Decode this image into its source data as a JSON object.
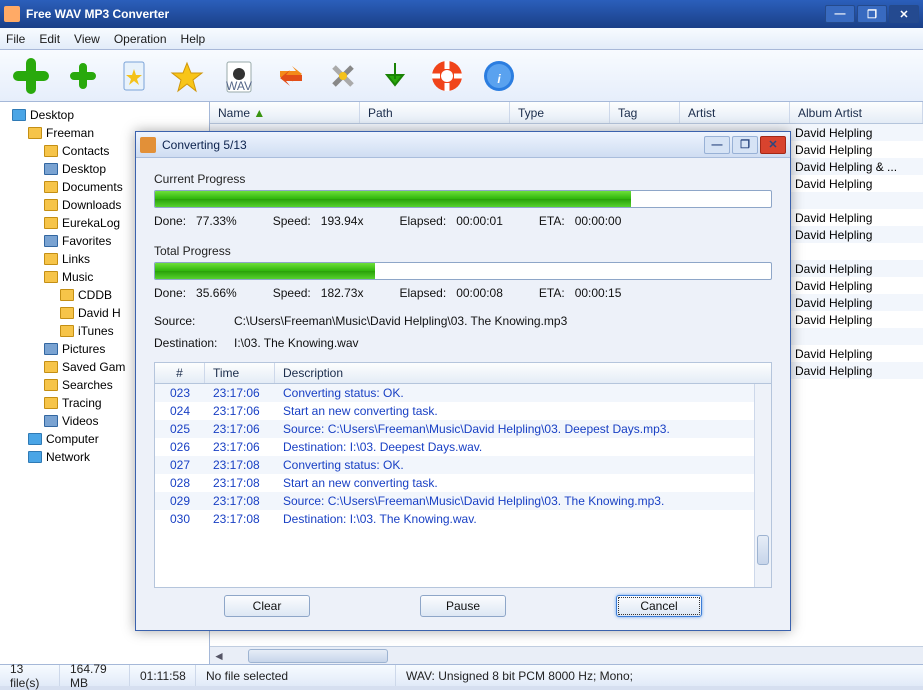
{
  "window": {
    "title": "Free WAV MP3 Converter"
  },
  "menu": [
    "File",
    "Edit",
    "View",
    "Operation",
    "Help"
  ],
  "toolbar_icons": [
    "add",
    "add-files",
    "favorites",
    "favorite-add",
    "output",
    "convert",
    "settings",
    "download",
    "help",
    "info"
  ],
  "tree": [
    {
      "ind": 0,
      "icon": "desk",
      "label": "Desktop"
    },
    {
      "ind": 1,
      "icon": "fld",
      "label": "Freeman"
    },
    {
      "ind": 2,
      "icon": "fld",
      "label": "Contacts"
    },
    {
      "ind": 2,
      "icon": "sp",
      "label": "Desktop"
    },
    {
      "ind": 2,
      "icon": "fld",
      "label": "Documents"
    },
    {
      "ind": 2,
      "icon": "fld",
      "label": "Downloads"
    },
    {
      "ind": 2,
      "icon": "fld",
      "label": "EurekaLog"
    },
    {
      "ind": 2,
      "icon": "sp",
      "label": "Favorites"
    },
    {
      "ind": 2,
      "icon": "fld",
      "label": "Links"
    },
    {
      "ind": 2,
      "icon": "fld",
      "label": "Music"
    },
    {
      "ind": 3,
      "icon": "fld",
      "label": "CDDB"
    },
    {
      "ind": 3,
      "icon": "fld",
      "label": "David H"
    },
    {
      "ind": 3,
      "icon": "fld",
      "label": "iTunes"
    },
    {
      "ind": 2,
      "icon": "sp",
      "label": "Pictures"
    },
    {
      "ind": 2,
      "icon": "fld",
      "label": "Saved Gam"
    },
    {
      "ind": 2,
      "icon": "fld",
      "label": "Searches"
    },
    {
      "ind": 2,
      "icon": "fld",
      "label": "Tracing"
    },
    {
      "ind": 2,
      "icon": "sp",
      "label": "Videos"
    },
    {
      "ind": 1,
      "icon": "net",
      "label": "Computer"
    },
    {
      "ind": 1,
      "icon": "net",
      "label": "Network"
    }
  ],
  "columns": {
    "name": "Name",
    "path": "Path",
    "type": "Type",
    "tag": "Tag",
    "artist": "Artist",
    "albumartist": "Album Artist"
  },
  "artist_rows": [
    "David Helpling",
    "David Helpling",
    "David Helpling & ...",
    "David Helpling",
    "",
    "David Helpling",
    "David Helpling",
    "",
    "David Helpling",
    "David Helpling",
    "David Helpling",
    "David Helpling",
    "",
    "David Helpling",
    "David Helpling"
  ],
  "status": {
    "files": "13 file(s)",
    "size": "164.79 MB",
    "dur": "01:11:58",
    "sel": "No file selected",
    "fmt": "WAV:   Unsigned 8 bit PCM  8000 Hz;  Mono;"
  },
  "dialog": {
    "title": "Converting 5/13",
    "current": {
      "label": "Current Progress",
      "donelab": "Done:",
      "done": "77.33%",
      "pct": 77.33,
      "speedlab": "Speed:",
      "speed": "193.94x",
      "elapsedlab": "Elapsed:",
      "elapsed": "00:00:01",
      "etalab": "ETA:",
      "eta": "00:00:00"
    },
    "total": {
      "label": "Total Progress",
      "donelab": "Done:",
      "done": "35.66%",
      "pct": 35.66,
      "speedlab": "Speed:",
      "speed": "182.73x",
      "elapsedlab": "Elapsed:",
      "elapsed": "00:00:08",
      "etalab": "ETA:",
      "eta": "00:00:15"
    },
    "source": {
      "label": "Source:",
      "value": "C:\\Users\\Freeman\\Music\\David Helpling\\03. The Knowing.mp3"
    },
    "dest": {
      "label": "Destination:",
      "value": "I:\\03. The Knowing.wav"
    },
    "loghead": {
      "n": "#",
      "time": "Time",
      "desc": "Description"
    },
    "log": [
      {
        "n": "023",
        "t": "23:17:06",
        "d": "Converting status: OK."
      },
      {
        "n": "024",
        "t": "23:17:06",
        "d": "Start an new converting task."
      },
      {
        "n": "025",
        "t": "23:17:06",
        "d": "Source:  C:\\Users\\Freeman\\Music\\David Helpling\\03. Deepest Days.mp3."
      },
      {
        "n": "026",
        "t": "23:17:06",
        "d": "Destination: I:\\03. Deepest Days.wav."
      },
      {
        "n": "027",
        "t": "23:17:08",
        "d": "Converting status: OK."
      },
      {
        "n": "028",
        "t": "23:17:08",
        "d": "Start an new converting task."
      },
      {
        "n": "029",
        "t": "23:17:08",
        "d": "Source:  C:\\Users\\Freeman\\Music\\David Helpling\\03. The Knowing.mp3."
      },
      {
        "n": "030",
        "t": "23:17:08",
        "d": "Destination: I:\\03. The Knowing.wav."
      }
    ],
    "buttons": {
      "clear": "Clear",
      "pause": "Pause",
      "cancel": "Cancel"
    }
  }
}
